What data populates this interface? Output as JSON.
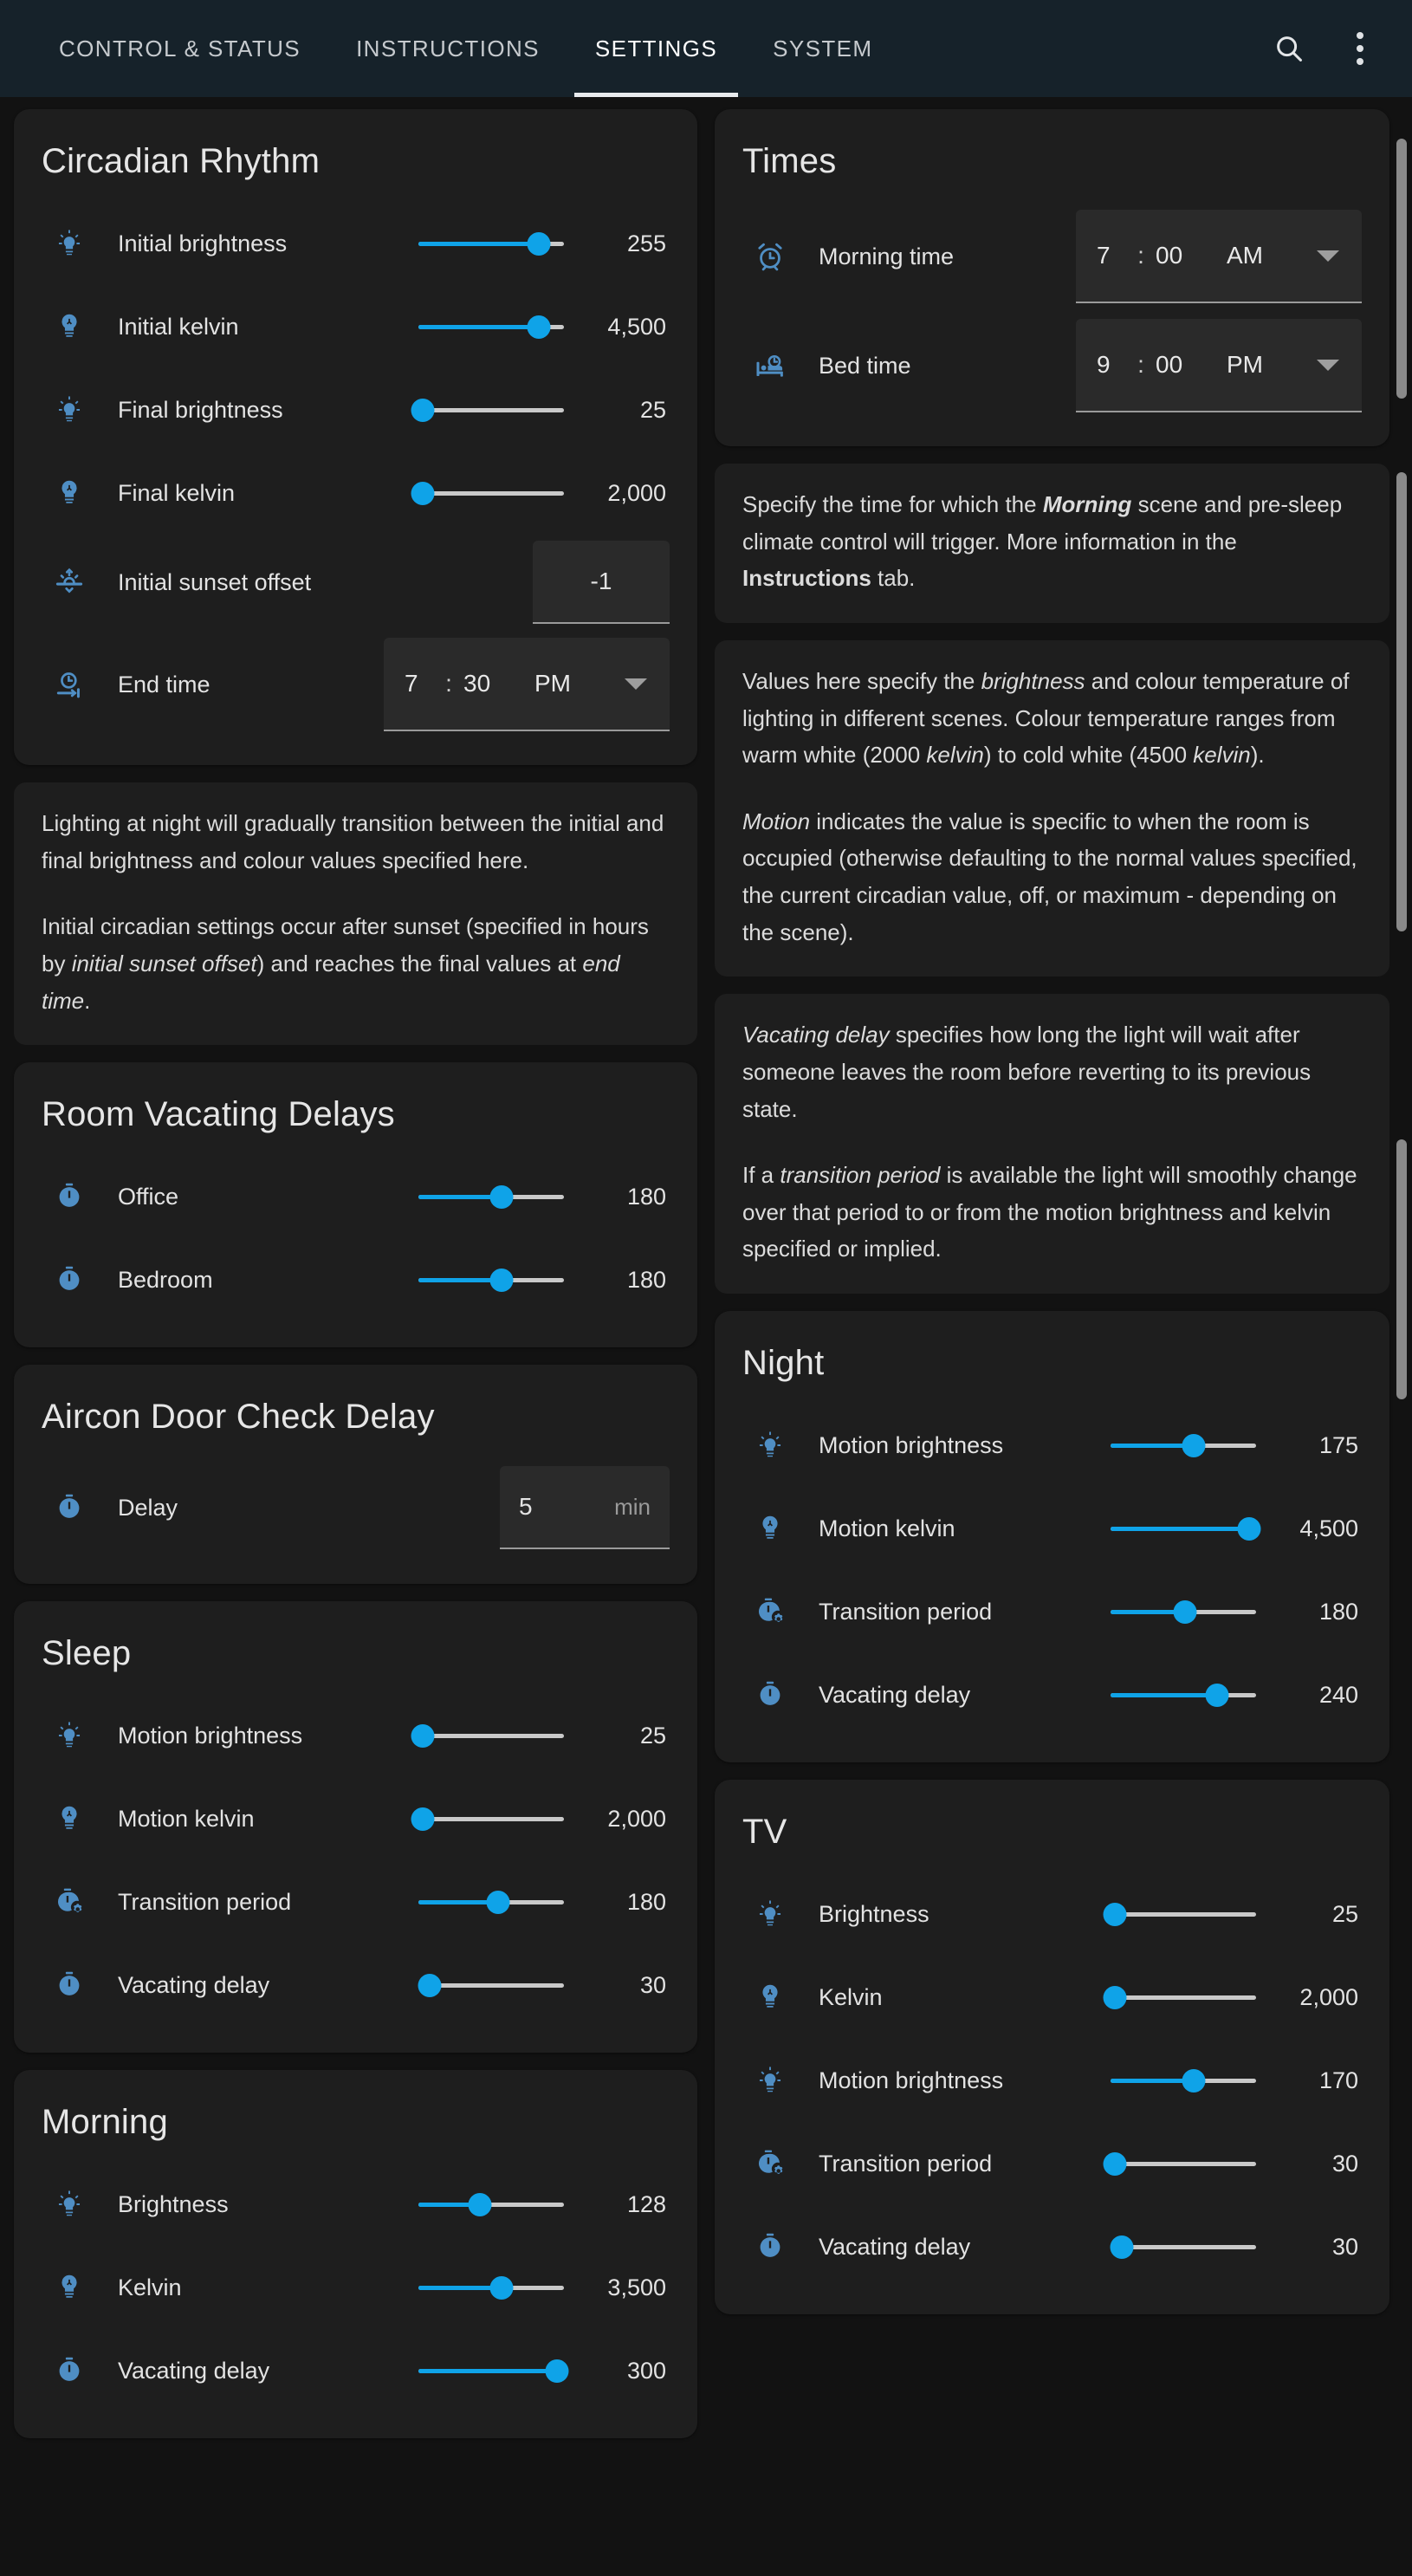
{
  "appbar": {
    "tabs": [
      {
        "label": "CONTROL & STATUS",
        "active": false
      },
      {
        "label": "INSTRUCTIONS",
        "active": false
      },
      {
        "label": "SETTINGS",
        "active": true
      },
      {
        "label": "SYSTEM",
        "active": false
      }
    ],
    "search_icon": "search-icon",
    "overflow_icon": "more-vert-icon"
  },
  "colors": {
    "accent": "#0fa3e8",
    "icon_blue": "#4f8ec4",
    "appbar_bg": "#16222a",
    "card_bg": "#1e1e1e",
    "page_bg": "#121212",
    "track": "#c9c9c9"
  },
  "left": {
    "circadian": {
      "title": "Circadian Rhythm",
      "rows": [
        {
          "icon": "bulb-rays-icon",
          "label": "Initial brightness",
          "type": "slider",
          "value": "255",
          "pct": 83
        },
        {
          "icon": "bulb-icon",
          "label": "Initial kelvin",
          "type": "slider",
          "value": "4,500",
          "pct": 83
        },
        {
          "icon": "bulb-rays-icon",
          "label": "Final brightness",
          "type": "slider",
          "value": "25",
          "pct": 3
        },
        {
          "icon": "bulb-icon",
          "label": "Final kelvin",
          "type": "slider",
          "value": "2,000",
          "pct": 3
        },
        {
          "icon": "sunset-icon",
          "label": "Initial sunset offset",
          "type": "number",
          "value": "-1"
        },
        {
          "icon": "clock-end-icon",
          "label": "End time",
          "type": "time",
          "hour": "7",
          "colon": ":",
          "minute": "30",
          "ampm": "PM"
        }
      ]
    },
    "circadian_info": {
      "p1_a": "Lighting at night will gradually transition between the initial and final brightness and colour values specified here.",
      "p2_a": "Initial circadian settings occur after sunset (specified in hours by ",
      "p2_em1": "initial sunset offset",
      "p2_b": ") and reaches the final values at ",
      "p2_em2": "end time",
      "p2_c": "."
    },
    "vacating": {
      "title": "Room Vacating Delays",
      "rows": [
        {
          "icon": "stopwatch-icon",
          "label": "Office",
          "type": "slider",
          "value": "180",
          "pct": 57
        },
        {
          "icon": "stopwatch-icon",
          "label": "Bedroom",
          "type": "slider",
          "value": "180",
          "pct": 57
        }
      ]
    },
    "aircon": {
      "title": "Aircon Door Check Delay",
      "rows": [
        {
          "icon": "stopwatch-icon",
          "label": "Delay",
          "type": "number_unit",
          "value": "5",
          "unit": "min"
        }
      ]
    },
    "sleep": {
      "title": "Sleep",
      "rows": [
        {
          "icon": "bulb-rays-icon",
          "label": "Motion brightness",
          "type": "slider",
          "value": "25",
          "pct": 3
        },
        {
          "icon": "bulb-icon",
          "label": "Motion kelvin",
          "type": "slider",
          "value": "2,000",
          "pct": 3
        },
        {
          "icon": "stopwatch-gear-icon",
          "label": "Transition period",
          "type": "slider",
          "value": "180",
          "pct": 55
        },
        {
          "icon": "stopwatch-icon",
          "label": "Vacating delay",
          "type": "slider",
          "value": "30",
          "pct": 8
        }
      ]
    },
    "morning": {
      "title": "Morning",
      "rows": [
        {
          "icon": "bulb-rays-icon",
          "label": "Brightness",
          "type": "slider",
          "value": "128",
          "pct": 42
        },
        {
          "icon": "bulb-icon",
          "label": "Kelvin",
          "type": "slider",
          "value": "3,500",
          "pct": 57
        },
        {
          "icon": "stopwatch-icon",
          "label": "Vacating delay",
          "type": "slider",
          "value": "300",
          "pct": 95
        }
      ]
    }
  },
  "right": {
    "times": {
      "title": "Times",
      "rows": [
        {
          "icon": "alarm-clock-icon",
          "label": "Morning time",
          "type": "time",
          "hour": "7",
          "colon": ":",
          "minute": "00",
          "ampm": "AM"
        },
        {
          "icon": "bed-clock-icon",
          "label": "Bed time",
          "type": "time",
          "hour": "9",
          "colon": ":",
          "minute": "00",
          "ampm": "PM"
        }
      ]
    },
    "times_info": {
      "a": "Specify the time for which the ",
      "bi": "Morning",
      "b": " scene and pre-sleep climate control will trigger. More information in the ",
      "bold": "Instructions",
      "c": " tab."
    },
    "values_info": {
      "p1_a": "Values here specify the ",
      "p1_em1": "brightness",
      "p1_b": " and colour temperature of lighting in different scenes. Colour temperature ranges from warm white (2000 ",
      "p1_em2": "kelvin",
      "p1_c": ") to cold white (4500 ",
      "p1_em3": "kelvin",
      "p1_d": ").",
      "p2_em": "Motion",
      "p2_a": " indicates the value is specific to when the room is occupied (otherwise defaulting to the normal values specified, the current circadian value, off, or maximum - depending on the scene)."
    },
    "delay_info": {
      "p1_em": "Vacating delay",
      "p1_a": " specifies how long the light will wait after someone leaves the room before reverting to its previous state.",
      "p2_a": "If a ",
      "p2_em": "transition period",
      "p2_b": " is available the light will smoothly change over that period to or from the motion brightness and kelvin specified or implied."
    },
    "night": {
      "title": "Night",
      "rows": [
        {
          "icon": "bulb-rays-icon",
          "label": "Motion brightness",
          "type": "slider",
          "value": "175",
          "pct": 57
        },
        {
          "icon": "bulb-icon",
          "label": "Motion kelvin",
          "type": "slider",
          "value": "4,500",
          "pct": 95
        },
        {
          "icon": "stopwatch-gear-icon",
          "label": "Transition period",
          "type": "slider",
          "value": "180",
          "pct": 51
        },
        {
          "icon": "stopwatch-icon",
          "label": "Vacating delay",
          "type": "slider",
          "value": "240",
          "pct": 73
        }
      ]
    },
    "tv": {
      "title": "TV",
      "rows": [
        {
          "icon": "bulb-rays-icon",
          "label": "Brightness",
          "type": "slider",
          "value": "25",
          "pct": 3
        },
        {
          "icon": "bulb-icon",
          "label": "Kelvin",
          "type": "slider",
          "value": "2,000",
          "pct": 3
        },
        {
          "icon": "bulb-rays-icon",
          "label": "Motion brightness",
          "type": "slider",
          "value": "170",
          "pct": 57
        },
        {
          "icon": "stopwatch-gear-icon",
          "label": "Transition period",
          "type": "slider",
          "value": "30",
          "pct": 3
        },
        {
          "icon": "stopwatch-icon",
          "label": "Vacating delay",
          "type": "slider",
          "value": "30",
          "pct": 8
        }
      ]
    }
  }
}
